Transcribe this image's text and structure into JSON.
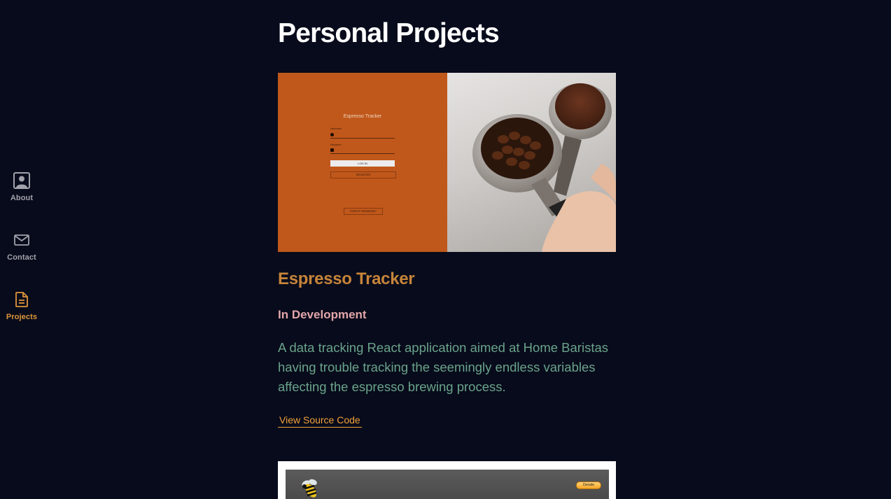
{
  "nav": {
    "items": [
      {
        "label": "About",
        "icon": "person-icon",
        "active": false
      },
      {
        "label": "Contact",
        "icon": "mail-icon",
        "active": false
      },
      {
        "label": "Projects",
        "icon": "document-icon",
        "active": true
      }
    ],
    "active_color": "#e0963b",
    "inactive_color": "#a1a1aa"
  },
  "main": {
    "title": "Personal Projects",
    "projects": [
      {
        "name": "Espresso Tracker",
        "status": "In Development",
        "description": "A data tracking React application aimed at Home Baristas having trouble tracking the seemingly endless variables affecting the espresso brewing process.",
        "link_label": "View Source Code",
        "preview": {
          "app_title": "Espresso Tracker",
          "username_label": "Username",
          "password_label": "Password",
          "login_label": "LOG IN",
          "register_label": "REGISTER",
          "forgot_label": "FORGOT PASSWORD?"
        }
      },
      {
        "preview": {
          "donate_label": "Donate"
        }
      }
    ]
  },
  "colors": {
    "background": "#070b1b",
    "title": "#ffffff",
    "project_title": "#c7843a",
    "status": "#e3a6aa",
    "description": "#6aa38a",
    "link": "#f2a03a",
    "preview_orange": "#c0581b"
  }
}
